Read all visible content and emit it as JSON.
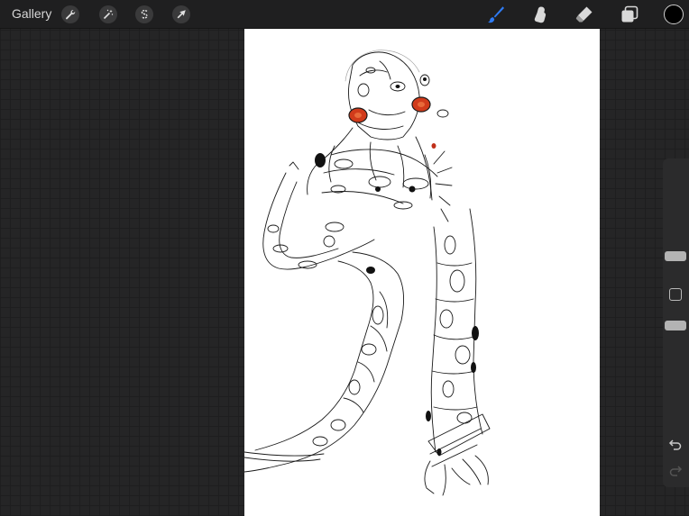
{
  "toolbar": {
    "gallery_label": "Gallery",
    "left_tools": [
      "wrench-icon",
      "magic-wand-icon",
      "selection-s-icon",
      "transform-arrow-icon"
    ],
    "right_tools": [
      "brush-icon",
      "smudge-icon",
      "eraser-icon",
      "layers-icon"
    ],
    "active_tool": "brush-icon",
    "accent_color": "#2f7cf6",
    "current_color": "#000000"
  },
  "sidebar": {
    "brush_size": 0.8,
    "brush_opacity": 0.25,
    "controls": [
      "brush-size-slider",
      "modify-button",
      "opacity-slider",
      "undo-icon",
      "redo-icon"
    ]
  },
  "canvas": {
    "background": "#ffffff",
    "artwork": "sketch"
  }
}
